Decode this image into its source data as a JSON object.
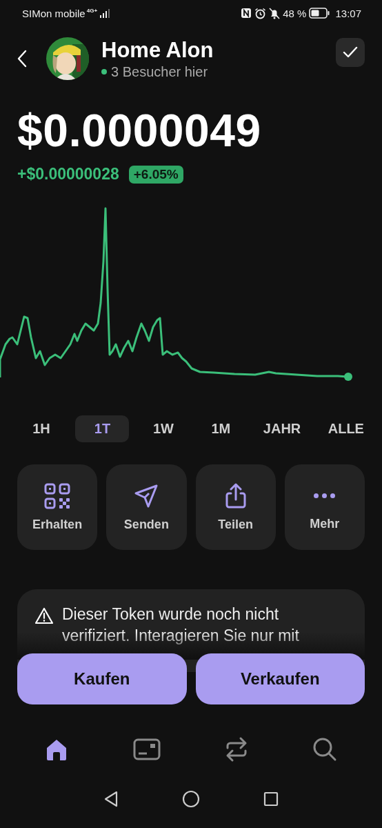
{
  "status_bar": {
    "carrier": "SIMon mobile",
    "network": "4G+",
    "battery": "48 %",
    "time": "13:07"
  },
  "header": {
    "title": "Home Alon",
    "visitors": "3 Besucher hier"
  },
  "price": {
    "value": "$0.0000049",
    "change": "+$0.00000028",
    "change_percent": "+6.05%"
  },
  "ranges": [
    {
      "label": "1H",
      "selected": false
    },
    {
      "label": "1T",
      "selected": true
    },
    {
      "label": "1W",
      "selected": false
    },
    {
      "label": "1M",
      "selected": false
    },
    {
      "label": "JAHR",
      "selected": false
    },
    {
      "label": "ALLE",
      "selected": false
    }
  ],
  "actions": [
    {
      "kind": "qr",
      "label": "Erhalten"
    },
    {
      "kind": "send",
      "label": "Senden"
    },
    {
      "kind": "share",
      "label": "Teilen"
    },
    {
      "kind": "more",
      "label": "Mehr"
    }
  ],
  "warning": {
    "text": "Dieser Token wurde noch nicht verifiziert. Interagieren Sie nur mit"
  },
  "trade_buttons": [
    "Kaufen",
    "Verkaufen"
  ],
  "nav": [
    {
      "kind": "home",
      "selected": true
    },
    {
      "kind": "wallet",
      "selected": false
    },
    {
      "kind": "swap",
      "selected": false
    },
    {
      "kind": "search",
      "selected": false
    }
  ],
  "system_nav": [
    {
      "kind": "back"
    },
    {
      "kind": "home"
    },
    {
      "kind": "recent"
    }
  ]
}
